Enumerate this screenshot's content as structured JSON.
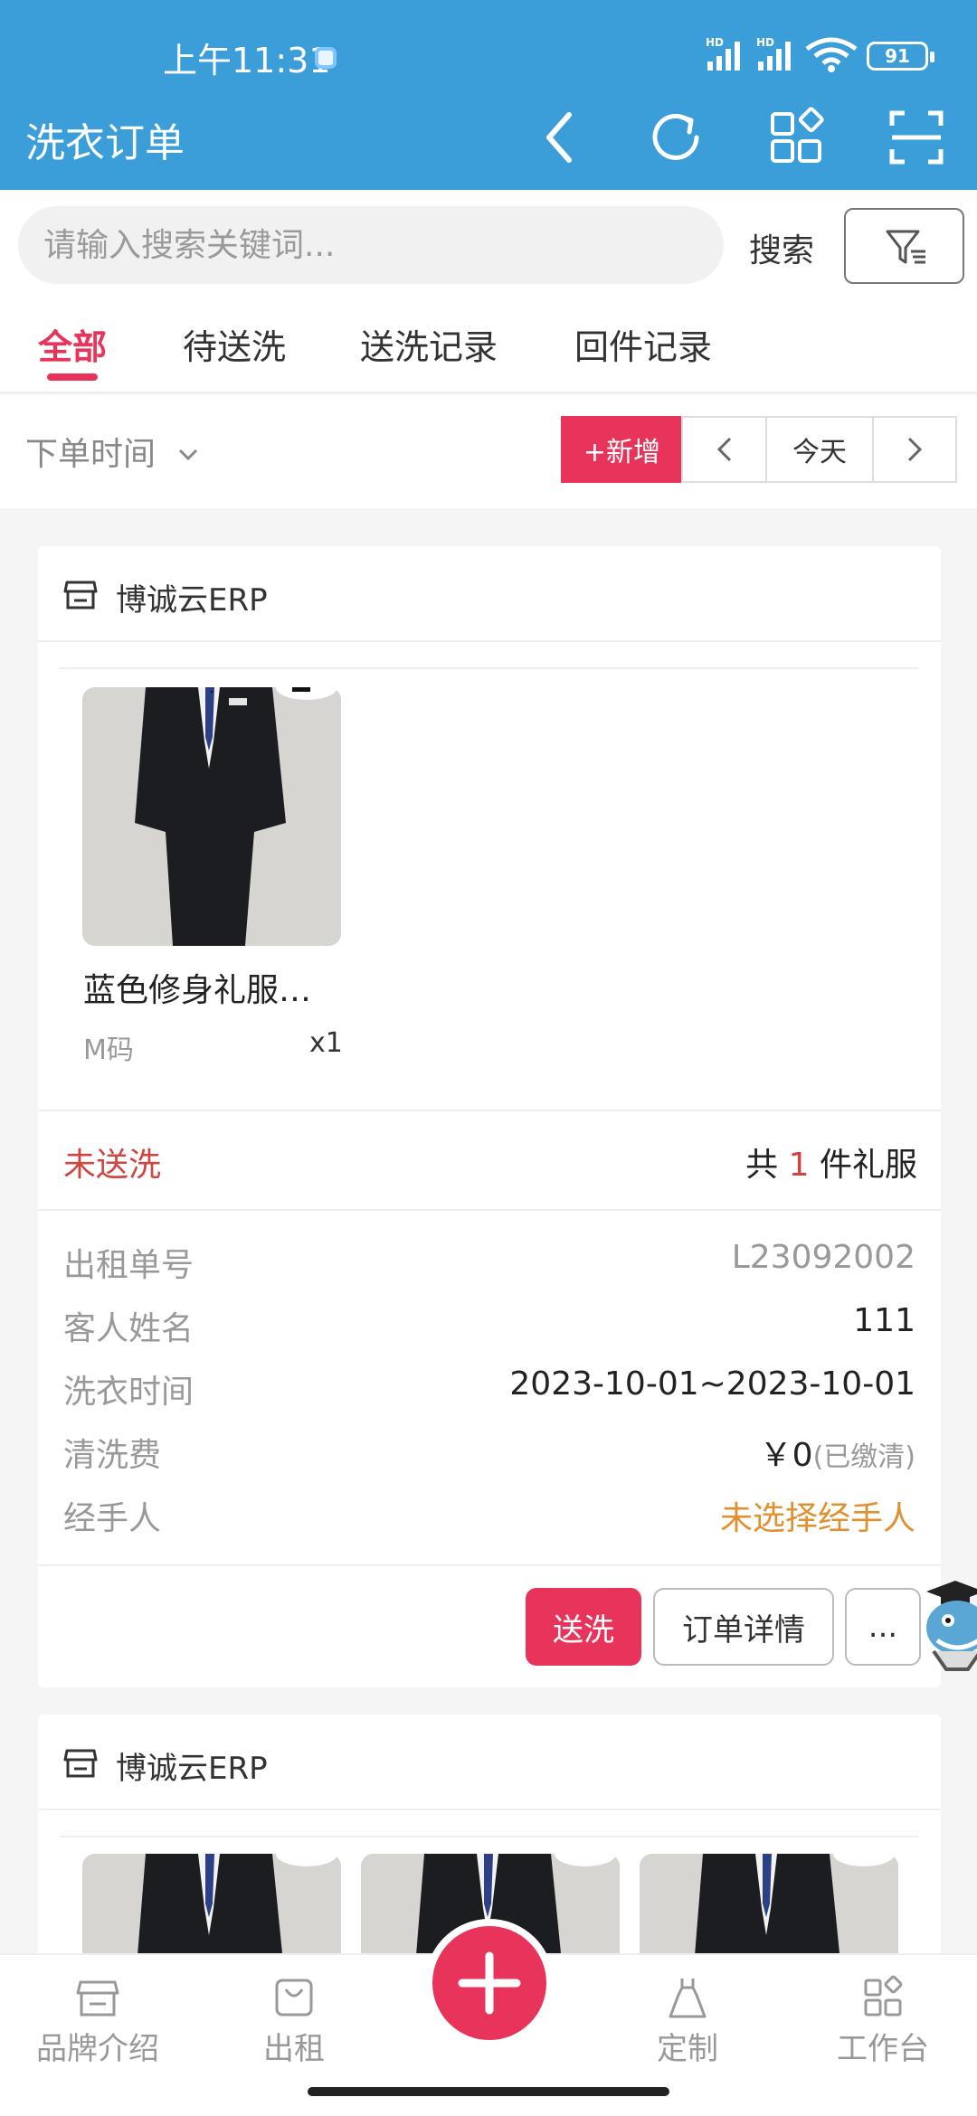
{
  "status_bar": {
    "time": "上午11:31",
    "battery": "91",
    "hd_label": "HD"
  },
  "header": {
    "title": "洗衣订单"
  },
  "search": {
    "placeholder": "请输入搜索关键词...",
    "button_label": "搜索"
  },
  "tabs": [
    {
      "label": "全部",
      "active": true
    },
    {
      "label": "待送洗",
      "active": false
    },
    {
      "label": "送洗记录",
      "active": false
    },
    {
      "label": "回件记录",
      "active": false
    }
  ],
  "filter": {
    "sort_label": "下单时间",
    "add_label": "+新增",
    "today_label": "今天"
  },
  "orders": [
    {
      "shop_name": "博诚云ERP",
      "product": {
        "name": "蓝色修身礼服…",
        "size": "M码",
        "qty": "x1"
      },
      "status": "未送洗",
      "count_prefix": "共",
      "count": "1",
      "count_suffix": "件礼服",
      "info": {
        "order_no_label": "出租单号",
        "order_no": "L23092002",
        "customer_label": "客人姓名",
        "customer": "111",
        "wash_time_label": "洗衣时间",
        "wash_time": "2023-10-01~2023-10-01",
        "fee_label": "清洗费",
        "fee": "￥0",
        "fee_note": "(已缴清)",
        "handler_label": "经手人",
        "handler": "未选择经手人"
      },
      "actions": {
        "wash": "送洗",
        "detail": "订单详情",
        "more": "..."
      }
    },
    {
      "shop_name": "博诚云ERP"
    }
  ],
  "bottom_nav": [
    {
      "label": "品牌介绍",
      "icon": "shop-icon"
    },
    {
      "label": "出租",
      "icon": "bag-icon"
    },
    {
      "label": "定制",
      "icon": "dress-icon"
    },
    {
      "label": "工作台",
      "icon": "grid-icon"
    }
  ],
  "colors": {
    "header": "#3b9ed9",
    "accent": "#e8345a",
    "status_red": "#d0453f",
    "orange": "#e0902f"
  }
}
